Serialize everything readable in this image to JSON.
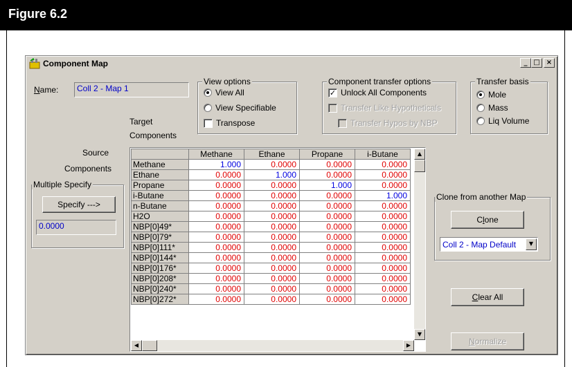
{
  "figure": {
    "label": "Figure 6.2"
  },
  "window": {
    "title": "Component Map",
    "controls": {
      "minimize": "_",
      "maximize": "□",
      "close": "×"
    }
  },
  "name_field": {
    "label": "Name:",
    "label_underline": "N",
    "label_rest": "ame:",
    "value": "Coll 2 - Map 1"
  },
  "view_options": {
    "title": "View options",
    "view_all": "View All",
    "view_specifiable": "View Specifiable",
    "transpose": "Transpose",
    "selected": "view_all"
  },
  "transfer_options": {
    "title": "Component transfer options",
    "unlock_all": "Unlock All Components",
    "transfer_like_hypo": "Transfer Like Hypotheticals",
    "transfer_hypos_nbp": "Transfer Hypos by NBP",
    "unlock_checked": true
  },
  "transfer_basis": {
    "title": "Transfer basis",
    "options": [
      "Mole",
      "Mass",
      "Liq Volume"
    ],
    "selected": "Mole"
  },
  "labels": {
    "target_line1": "Target",
    "target_line2": "Components",
    "source_line1": "Source",
    "source_line2": "Components"
  },
  "multiple_specify": {
    "title": "Multiple Specify",
    "button": "Specify --->",
    "value": "0.0000"
  },
  "clone": {
    "title": "Clone from another Map",
    "button_underline": "l",
    "button_pre": "C",
    "button_post": "one",
    "combo_value": "Coll 2 - Map Default"
  },
  "buttons": {
    "clear_all_underline": "C",
    "clear_all_rest": "lear All",
    "normalize_underline": "N",
    "normalize_rest": "ormalize"
  },
  "grid": {
    "columns": [
      "Methane",
      "Ethane",
      "Propane",
      "i-Butane"
    ],
    "rows": [
      {
        "name": "Methane",
        "values": [
          "1.000",
          "0.0000",
          "0.0000",
          "0.0000"
        ]
      },
      {
        "name": "Ethane",
        "values": [
          "0.0000",
          "1.000",
          "0.0000",
          "0.0000"
        ]
      },
      {
        "name": "Propane",
        "values": [
          "0.0000",
          "0.0000",
          "1.000",
          "0.0000"
        ]
      },
      {
        "name": "i-Butane",
        "values": [
          "0.0000",
          "0.0000",
          "0.0000",
          "1.000"
        ]
      },
      {
        "name": "n-Butane",
        "values": [
          "0.0000",
          "0.0000",
          "0.0000",
          "0.0000"
        ]
      },
      {
        "name": "H2O",
        "values": [
          "0.0000",
          "0.0000",
          "0.0000",
          "0.0000"
        ]
      },
      {
        "name": "NBP[0]49*",
        "values": [
          "0.0000",
          "0.0000",
          "0.0000",
          "0.0000"
        ]
      },
      {
        "name": "NBP[0]79*",
        "values": [
          "0.0000",
          "0.0000",
          "0.0000",
          "0.0000"
        ]
      },
      {
        "name": "NBP[0]111*",
        "values": [
          "0.0000",
          "0.0000",
          "0.0000",
          "0.0000"
        ]
      },
      {
        "name": "NBP[0]144*",
        "values": [
          "0.0000",
          "0.0000",
          "0.0000",
          "0.0000"
        ]
      },
      {
        "name": "NBP[0]176*",
        "values": [
          "0.0000",
          "0.0000",
          "0.0000",
          "0.0000"
        ]
      },
      {
        "name": "NBP[0]208*",
        "values": [
          "0.0000",
          "0.0000",
          "0.0000",
          "0.0000"
        ]
      },
      {
        "name": "NBP[0]240*",
        "values": [
          "0.0000",
          "0.0000",
          "0.0000",
          "0.0000"
        ]
      },
      {
        "name": "NBP[0]272*",
        "values": [
          "0.0000",
          "0.0000",
          "0.0000",
          "0.0000"
        ]
      }
    ]
  },
  "colors": {
    "value_zero": "#e00000",
    "value_one": "#0000e0",
    "input_text": "#0000c8"
  }
}
